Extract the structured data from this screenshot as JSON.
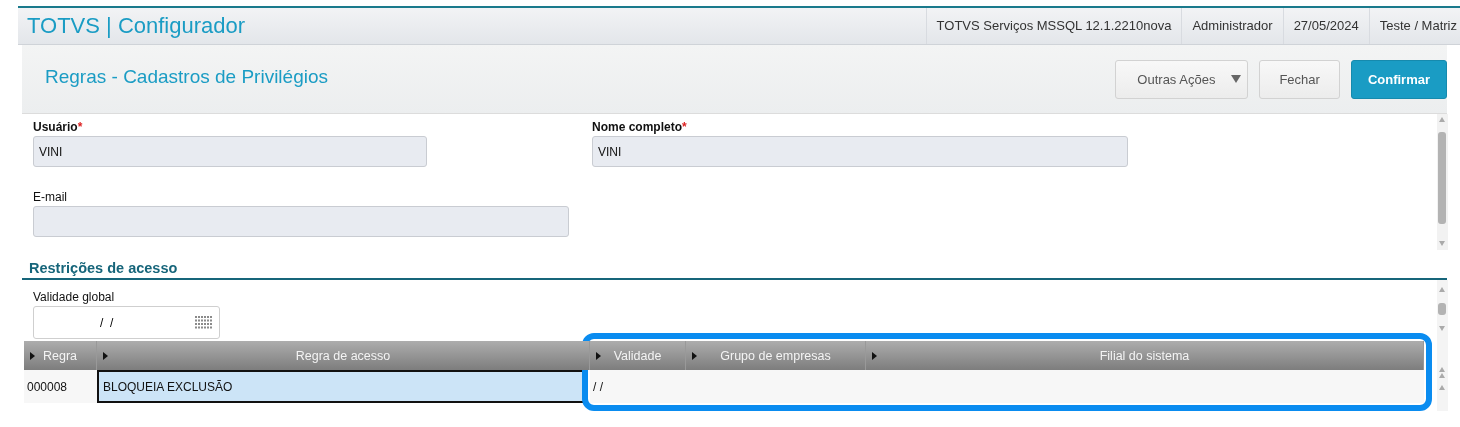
{
  "app": {
    "title": "TOTVS | Configurador",
    "status": [
      "TOTVS Serviços MSSQL 12.1.2210nova",
      "Administrador",
      "27/05/2024",
      "Teste / Matriz"
    ]
  },
  "page": {
    "title": "Regras - Cadastros de Privilégios",
    "buttons": [
      {
        "label": "Outras Ações",
        "kind": "dropdown"
      },
      {
        "label": "Fechar",
        "kind": "default"
      },
      {
        "label": "Confirmar",
        "kind": "primary"
      }
    ]
  },
  "fields": [
    {
      "label": "Usuário",
      "required_mark": "*",
      "value": "VINI"
    },
    {
      "label": "Nome completo",
      "required_mark": "*",
      "value": "VINI"
    },
    {
      "label": "E-mail"
    }
  ],
  "section": {
    "title": "Restrições de acesso",
    "validity": {
      "label": "Validade global",
      "value": "/  /"
    }
  },
  "table": {
    "columns": [
      {
        "label": "Regra",
        "highlighted": false
      },
      {
        "label": "Regra de acesso",
        "highlighted": false
      },
      {
        "label": "Validade",
        "highlighted": true
      },
      {
        "label": "Grupo de empresas",
        "highlighted": true
      },
      {
        "label": "Filial do sistema",
        "highlighted": true
      }
    ],
    "rows": [
      {
        "cells": [
          {
            "text": "000008",
            "selected": false
          },
          {
            "text": "BLOQUEIA EXCLUSÃO",
            "selected": true
          },
          {
            "text": "/ /",
            "selected": false
          },
          {
            "selected": false
          },
          {
            "selected": false
          }
        ]
      }
    ]
  }
}
